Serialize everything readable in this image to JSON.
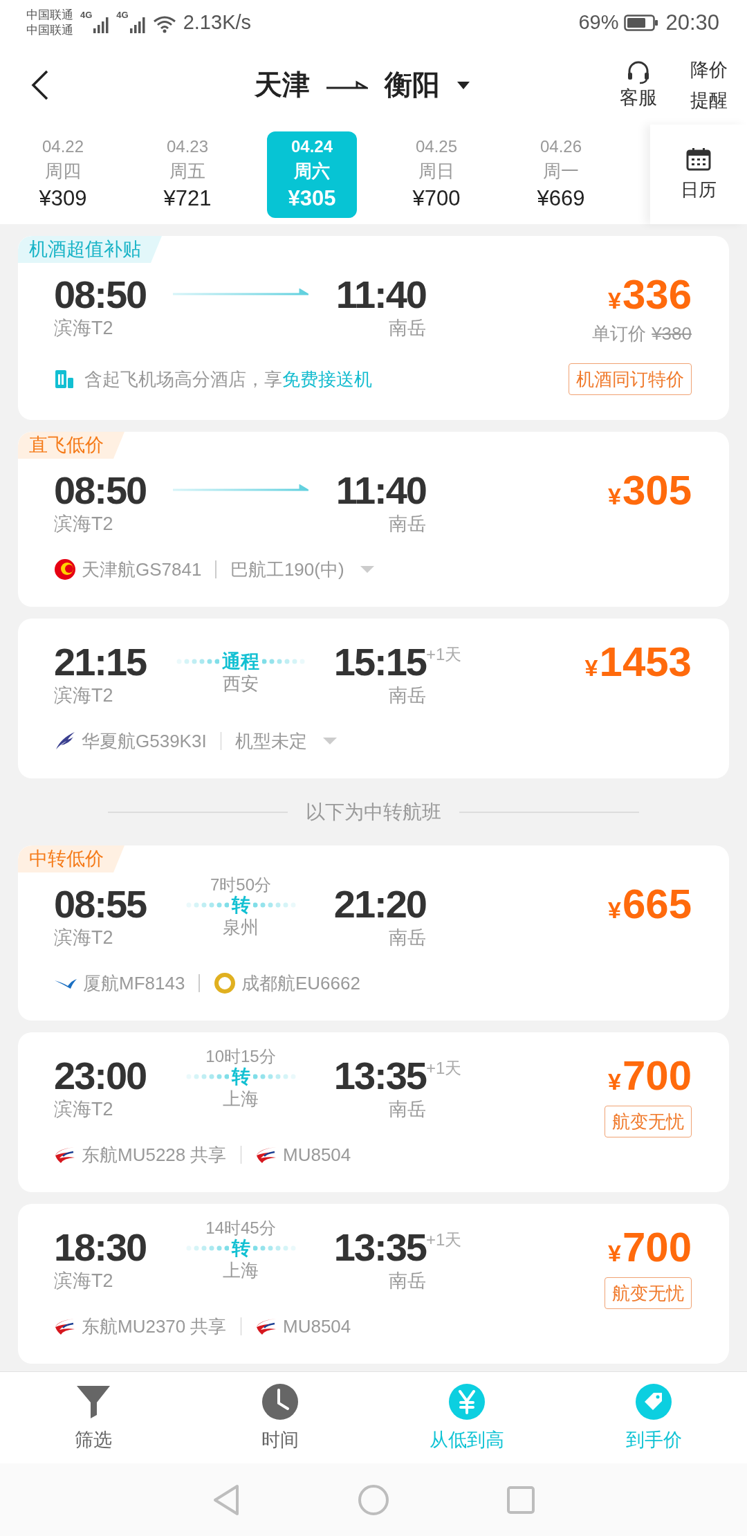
{
  "status_bar": {
    "carriers": [
      "中国联通",
      "中国联通"
    ],
    "networks": [
      "4G",
      "4G"
    ],
    "speed": "2.13K/s",
    "battery": "69%",
    "time": "20:30"
  },
  "header": {
    "from": "天津",
    "to": "衡阳",
    "service": "客服",
    "alert": "降价提醒"
  },
  "dates": [
    {
      "date": "04.22",
      "weekday": "周四",
      "price": "¥309",
      "selected": false
    },
    {
      "date": "04.23",
      "weekday": "周五",
      "price": "¥721",
      "selected": false
    },
    {
      "date": "04.24",
      "weekday": "周六",
      "price": "¥305",
      "selected": true
    },
    {
      "date": "04.25",
      "weekday": "周日",
      "price": "¥700",
      "selected": false
    },
    {
      "date": "04.26",
      "weekday": "周一",
      "price": "¥669",
      "selected": false
    }
  ],
  "calendar": "日历",
  "direct_flights": [
    {
      "tag": {
        "text": "机酒超值补贴",
        "kind": "hotel"
      },
      "depart": {
        "time": "08:50",
        "airport": "滨海T2"
      },
      "route": {
        "kind": "direct"
      },
      "arrive": {
        "time": "11:40",
        "airport": "南岳"
      },
      "price": {
        "symbol": "¥",
        "amount": "336"
      },
      "single_price": {
        "label": "单订价",
        "amount": "¥380"
      },
      "hotel_note": {
        "text": "含起飞机场高分酒店，享",
        "link": "免费接送机"
      },
      "badge": "机酒同订特价"
    },
    {
      "tag": {
        "text": "直飞低价",
        "kind": "deal"
      },
      "depart": {
        "time": "08:50",
        "airport": "滨海T2"
      },
      "route": {
        "kind": "direct"
      },
      "arrive": {
        "time": "11:40",
        "airport": "南岳"
      },
      "price": {
        "symbol": "¥",
        "amount": "305"
      },
      "carriers": [
        {
          "kind": "tianjin",
          "name": "天津航GS7841"
        }
      ],
      "model": "巴航工190(中)",
      "expandable": true
    },
    {
      "depart": {
        "time": "21:15",
        "airport": "滨海T2"
      },
      "route": {
        "kind": "through",
        "label": "通程",
        "city": "西安"
      },
      "arrive": {
        "time": "15:15",
        "airport": "南岳",
        "next_day": "+1天"
      },
      "price": {
        "symbol": "¥",
        "amount": "1453"
      },
      "carriers": [
        {
          "kind": "chinaexpress",
          "name": "华夏航G539K3I"
        }
      ],
      "model": "机型未定",
      "expandable": true
    }
  ],
  "transfer_section": {
    "title": "以下为中转航班",
    "flights": [
      {
        "tag": {
          "text": "中转低价",
          "kind": "deal"
        },
        "depart": {
          "time": "08:55",
          "airport": "滨海T2"
        },
        "route": {
          "kind": "transfer",
          "duration": "7时50分",
          "label": "转",
          "city": "泉州"
        },
        "arrive": {
          "time": "21:20",
          "airport": "南岳"
        },
        "price": {
          "symbol": "¥",
          "amount": "665"
        },
        "carriers": [
          {
            "kind": "xiamen",
            "name": "厦航MF8143"
          },
          {
            "kind": "chengdu",
            "name": "成都航EU6662"
          }
        ],
        "expandable": false
      },
      {
        "depart": {
          "time": "23:00",
          "airport": "滨海T2"
        },
        "route": {
          "kind": "transfer",
          "duration": "10时15分",
          "label": "转",
          "city": "上海"
        },
        "arrive": {
          "time": "13:35",
          "airport": "南岳",
          "next_day": "+1天"
        },
        "price": {
          "symbol": "¥",
          "amount": "700"
        },
        "badge": "航变无忧",
        "carriers": [
          {
            "kind": "eastern",
            "name": "东航MU5228 共享"
          },
          {
            "kind": "eastern",
            "name": "MU8504"
          }
        ],
        "expandable": false
      },
      {
        "depart": {
          "time": "18:30",
          "airport": "滨海T2"
        },
        "route": {
          "kind": "transfer",
          "duration": "14时45分",
          "label": "转",
          "city": "上海"
        },
        "arrive": {
          "time": "13:35",
          "airport": "南岳",
          "next_day": "+1天"
        },
        "price": {
          "symbol": "¥",
          "amount": "700"
        },
        "badge": "航变无忧",
        "carriers": [
          {
            "kind": "eastern",
            "name": "东航MU2370 共享"
          },
          {
            "kind": "eastern",
            "name": "MU8504"
          }
        ],
        "expandable": false
      }
    ]
  },
  "bottom_nav": [
    {
      "label": "筛选",
      "kind": "filter",
      "selected": false
    },
    {
      "label": "时间",
      "kind": "clock",
      "selected": false
    },
    {
      "label": "从低到高",
      "kind": "yen",
      "selected": true
    },
    {
      "label": "到手价",
      "kind": "tag",
      "selected": true
    }
  ]
}
